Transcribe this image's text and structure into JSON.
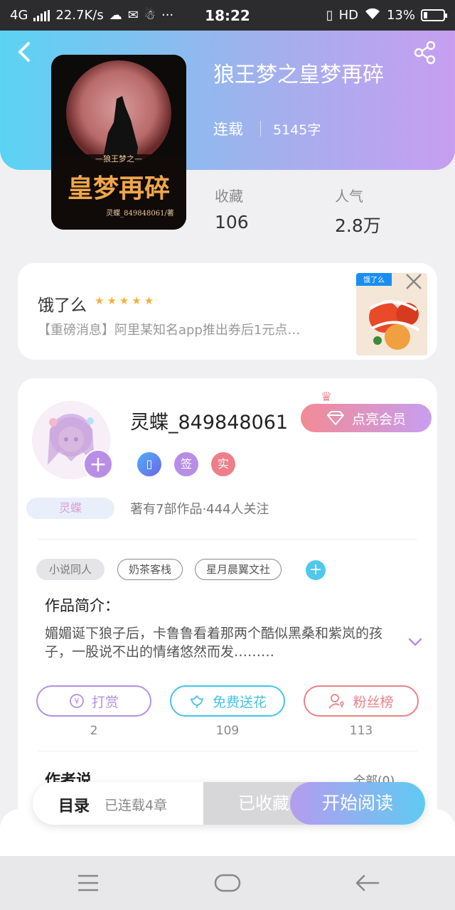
{
  "status_bar": {
    "network": "4G",
    "speed": "22.7K/s",
    "more": "···",
    "time": "18:22",
    "hd": "HD",
    "battery": "13%"
  },
  "book": {
    "title": "狼王梦之皇梦再碎",
    "status": "连载",
    "word_count": "5145字",
    "cover_title": "皇梦再碎",
    "cover_subtitle": "—狼王梦之—",
    "cover_author": "灵蝶_849848061/著",
    "stats": [
      {
        "label": "收藏",
        "value": "106"
      },
      {
        "label": "人气",
        "value": "2.8万"
      }
    ]
  },
  "ad": {
    "title": "饿了么",
    "stars": "★★★★★",
    "description": "【重磅消息】阿里某知名app推出券后1元点…",
    "logo_text": "饿了么"
  },
  "author": {
    "name": "灵蝶_849848061",
    "vip_label": "点亮会员",
    "badges": [
      "签",
      "实"
    ],
    "name_tag": "灵蝶",
    "stats": "著有7部作品·444人关注",
    "tags": [
      "小说同人",
      "奶茶客栈",
      "星月晨翼文社"
    ],
    "intro_title": "作品简介：",
    "intro_text": "媚媚诞下狼子后，卡鲁鲁看着那两个酷似黑桑和紫岚的孩子，一股说不出的情绪悠然而发………",
    "actions": [
      {
        "label": "打赏",
        "count": "2",
        "color": "#b48fe0"
      },
      {
        "label": "免费送花",
        "count": "109",
        "color": "#45c3e8"
      },
      {
        "label": "粉丝榜",
        "count": "113",
        "color": "#ee7f88"
      }
    ],
    "author_says": "作者说",
    "all_link": "全部(0)"
  },
  "bottom_bar": {
    "toc_label": "目录",
    "toc_sub": "已连载4章",
    "collected_label": "已收藏",
    "read_label": "开始阅读"
  }
}
